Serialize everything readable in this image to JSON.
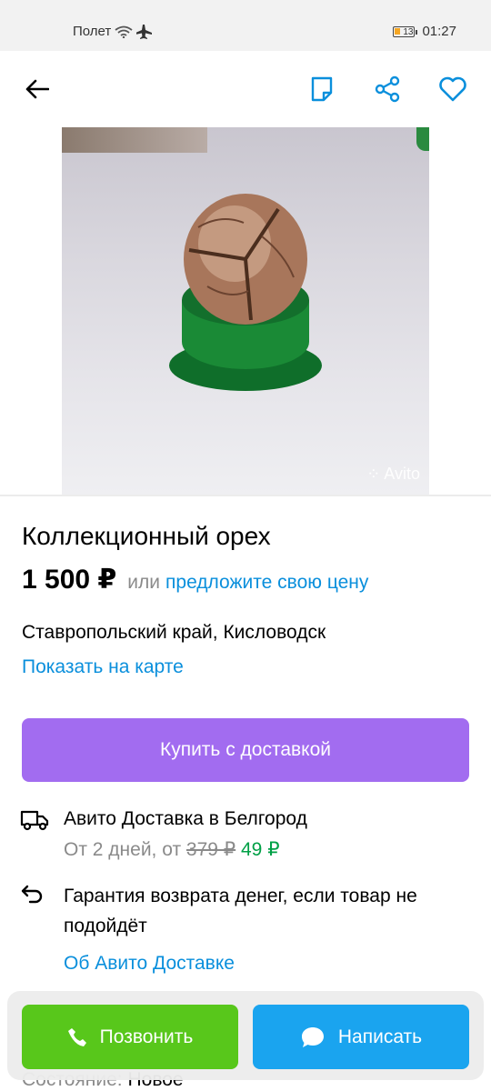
{
  "status_bar": {
    "airplane_text": "Полет",
    "battery": "13",
    "time": "01:27"
  },
  "app_bar": {
    "icons": [
      "back-arrow-icon",
      "note-icon",
      "share-icon",
      "heart-icon"
    ]
  },
  "photo": {
    "watermark": "Avito"
  },
  "listing": {
    "title": "Коллекционный орех",
    "price": "1 500 ₽",
    "or": "или",
    "offer_link": "предложите свою цену",
    "location": "Ставропольский край, Кисловодск",
    "map_link": "Показать на карте",
    "buy_button": "Купить с доставкой"
  },
  "delivery": {
    "title": "Авито Доставка в Белгород",
    "sub_prefix": "От 2 дней, от",
    "old_price": "379 ₽",
    "new_price": "49 ₽",
    "guarantee": "Гарантия возврата денег, если товар не подойдёт",
    "about_link": "Об Авито Доставке"
  },
  "condition": {
    "label": "Состояние:",
    "value": "Новое"
  },
  "bottom_bar": {
    "call": "Позвонить",
    "message": "Написать"
  },
  "colors": {
    "accent_blue": "#0a8fdc",
    "buy_purple": "#a26cf0",
    "call_green": "#58c71b",
    "message_blue": "#1aa4ef",
    "price_green": "#00a046"
  }
}
